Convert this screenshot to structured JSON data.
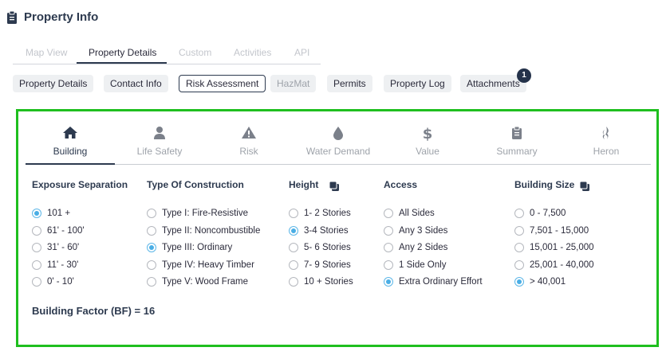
{
  "header": {
    "title": "Property Info",
    "icon": "clipboard-icon"
  },
  "top_tabs": [
    "Map View",
    "Property Details",
    "Custom",
    "Activities",
    "API"
  ],
  "pills": [
    {
      "label": "Property Details"
    },
    {
      "label": "Contact Info"
    },
    {
      "label": "Risk Assessment",
      "state": "active"
    },
    {
      "label": "HazMat",
      "state": "disabled"
    },
    {
      "label": "Permits"
    },
    {
      "label": "Property Log"
    },
    {
      "label": "Attachments",
      "badge": "1"
    }
  ],
  "sub_tabs": [
    {
      "label": "Building",
      "icon": "home-icon"
    },
    {
      "label": "Life Safety",
      "icon": "person-icon"
    },
    {
      "label": "Risk",
      "icon": "warning-icon"
    },
    {
      "label": "Water Demand",
      "icon": "water-drop-icon"
    },
    {
      "label": "Value",
      "icon": "dollar-icon"
    },
    {
      "label": "Summary",
      "icon": "clipboard-icon"
    },
    {
      "label": "Heron",
      "icon": "fire-icon"
    }
  ],
  "columns": [
    {
      "title": "Exposure Separation",
      "options": [
        "101 +",
        "61' - 100'",
        "31' - 60'",
        "11' - 30'",
        "0' - 10'"
      ],
      "selected": 0
    },
    {
      "title": "Type Of Construction",
      "options": [
        "Type I: Fire-Resistive",
        "Type II: Noncombustible",
        "Type III: Ordinary",
        "Type IV: Heavy Timber",
        "Type V: Wood Frame"
      ],
      "selected": 2
    },
    {
      "title": "Height",
      "options": [
        "1- 2 Stories",
        "3-4 Stories",
        "5- 6 Stories",
        "7- 9 Stories",
        "10 + Stories"
      ],
      "selected": 1
    },
    {
      "title": "Access",
      "options": [
        "All Sides",
        "Any 3 Sides",
        "Any 2 Sides",
        "1 Side Only",
        "Extra Ordinary Effort"
      ],
      "selected": 4
    },
    {
      "title": "Building Size",
      "options": [
        "0 - 7,500",
        "7,501 - 15,000",
        "15,001 - 25,000",
        "25,001 - 40,000",
        "> 40,001"
      ],
      "selected": 4
    }
  ],
  "building_factor": "Building Factor (BF) = 16",
  "colors": {
    "accent": "#2d3a4f",
    "radio": "#4aaee5",
    "frame": "#1fbf1f"
  }
}
